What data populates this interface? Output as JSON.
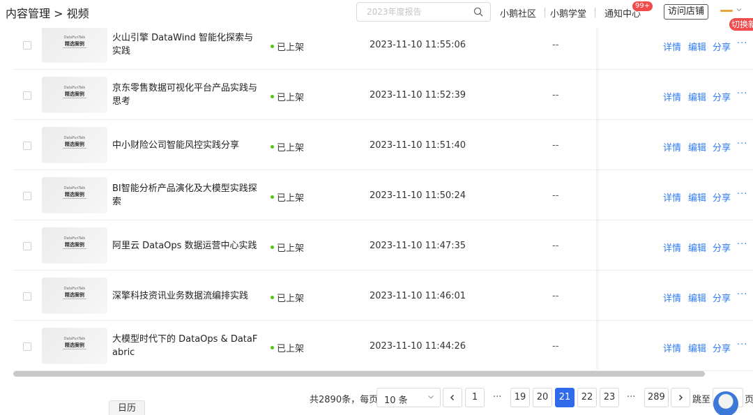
{
  "header": {
    "breadcrumb": "内容管理 > 视频",
    "search_placeholder": "2023年度报告",
    "nav": [
      "小鹅社区",
      "小鹅学堂",
      "通知中心"
    ],
    "notification_badge": "99+",
    "visit_store": "访问店铺",
    "switch_tag": "切换新"
  },
  "thumbnail": {
    "brand": "DataFunTalk",
    "title": "精选案例"
  },
  "rows": [
    {
      "title": "火山引擎 DataWind 智能化探索与实践",
      "status": "已上架",
      "time": "2023-11-10 11:55:06",
      "placeholder": "--"
    },
    {
      "title": "京东零售数据可视化平台产品实践与思考",
      "status": "已上架",
      "time": "2023-11-10 11:52:39",
      "placeholder": "--"
    },
    {
      "title": "中小财险公司智能风控实践分享",
      "status": "已上架",
      "time": "2023-11-10 11:51:40",
      "placeholder": "--"
    },
    {
      "title": "BI智能分析产品演化及大模型实践探索",
      "status": "已上架",
      "time": "2023-11-10 11:50:24",
      "placeholder": "--"
    },
    {
      "title": "阿里云 DataOps 数据运营中心实践",
      "status": "已上架",
      "time": "2023-11-10 11:47:35",
      "placeholder": "--"
    },
    {
      "title": "深擎科技资讯业务数据流编排实践",
      "status": "已上架",
      "time": "2023-11-10 11:46:01",
      "placeholder": "--"
    },
    {
      "title": "大模型时代下的 DataOps & DataFabric",
      "status": "已上架",
      "time": "2023-11-10 11:44:26",
      "placeholder": "--"
    }
  ],
  "actions": {
    "detail": "详情",
    "edit": "编辑",
    "share": "分享",
    "more": "···"
  },
  "pagination": {
    "total": "共2890条，每页",
    "page_size": "10 条",
    "pages": [
      "1",
      "19",
      "20",
      "21",
      "22",
      "23",
      "289"
    ],
    "current": "21",
    "ellipsis": "···",
    "jump_label": "跳至",
    "page_suffix": "页"
  },
  "calendar_tab": "日历",
  "colors": {
    "link": "#2f7cf6",
    "active_page": "#2f6bea",
    "status_dot": "#52c41a",
    "badge": "#f04a4a"
  }
}
